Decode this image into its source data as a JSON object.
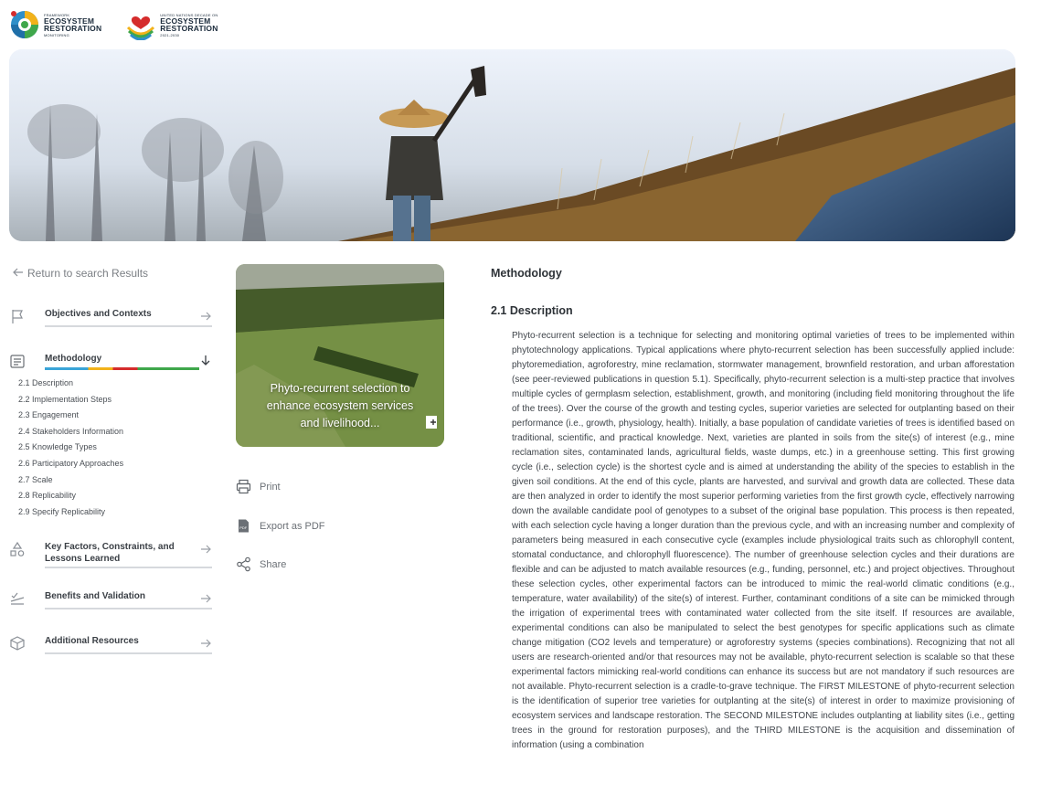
{
  "logos": {
    "framework": {
      "line1": "FRAMEWORK",
      "line2": "ECOSYSTEM",
      "line3": "RESTORATION",
      "line4": "MONITORING"
    },
    "undecade": {
      "line1": "UNITED NATIONS DECADE ON",
      "line2": "ECOSYSTEM",
      "line3": "RESTORATION",
      "line4": "2021-2030"
    }
  },
  "sidebar": {
    "back_label": "Return to search Results",
    "items": [
      {
        "label": "Objectives and Contexts",
        "icon": "flag-icon"
      },
      {
        "label": "Methodology",
        "icon": "list-icon"
      },
      {
        "label": "Key Factors, Constraints, and Lessons Learned",
        "icon": "shapes-icon"
      },
      {
        "label": "Benefits and Validation",
        "icon": "checklist-icon"
      },
      {
        "label": "Additional Resources",
        "icon": "cube-icon"
      }
    ],
    "methodology_subitems": [
      "2.1 Description",
      "2.2 Implementation Steps",
      "2.3 Engagement",
      "2.4 Stakeholders Information",
      "2.5 Knowledge Types",
      "2.6 Participatory Approaches",
      "2.7 Scale",
      "2.8 Replicability",
      "2.9 Specify Replicability"
    ]
  },
  "card": {
    "caption_line1": "Phyto-recurrent selection to",
    "caption_line2": "enhance ecosystem services",
    "caption_line3": "and livelihood..."
  },
  "actions": {
    "print": "Print",
    "export": "Export as PDF",
    "share": "Share"
  },
  "content": {
    "section_title": "Methodology",
    "subsection_title": "2.1 Description",
    "description": "Phyto-recurrent selection is a technique for selecting and monitoring optimal varieties of trees to be implemented within phytotechnology applications. Typical applications where phyto-recurrent selection has been successfully applied include: phytoremediation, agroforestry, mine reclamation, stormwater management, brownfield restoration, and urban afforestation (see peer-reviewed publications in question 5.1). Specifically, phyto-recurrent selection is a multi-step practice that involves multiple cycles of germplasm selection, establishment, growth, and monitoring (including field monitoring throughout the life of the trees). Over the course of the growth and testing cycles, superior varieties are selected for outplanting based on their performance (i.e., growth, physiology, health). Initially, a base population of candidate varieties of trees is identified based on traditional, scientific, and practical knowledge. Next, varieties are planted in soils from the site(s) of interest (e.g., mine reclamation sites, contaminated lands, agricultural fields, waste dumps, etc.) in a greenhouse setting. This first growing cycle (i.e., selection cycle) is the shortest cycle and is aimed at understanding the ability of the species to establish in the given soil conditions. At the end of this cycle, plants are harvested, and survival and growth data are collected. These data are then analyzed in order to identify the most superior performing varieties from the first growth cycle, effectively narrowing down the available candidate pool of genotypes to a subset of the original base population. This process is then repeated, with each selection cycle having a longer duration than the previous cycle, and with an increasing number and complexity of parameters being measured in each consecutive cycle (examples include physiological traits such as chlorophyll content, stomatal conductance, and chlorophyll fluorescence). The number of greenhouse selection cycles and their durations are flexible and can be adjusted to match available resources (e.g., funding, personnel, etc.) and project objectives. Throughout these selection cycles, other experimental factors can be introduced to mimic the real-world climatic conditions (e.g., temperature, water availability) of the site(s) of interest. Further, contaminant conditions of a site can be mimicked through the irrigation of experimental trees with contaminated water collected from the site itself. If resources are available, experimental conditions can also be manipulated to select the best genotypes for specific applications such as climate change mitigation (CO2 levels and temperature) or agroforestry systems (species combinations). Recognizing that not all users are research-oriented and/or that resources may not be available, phyto-recurrent selection is scalable so that these experimental factors mimicking real-world conditions can enhance its success but are not mandatory if such resources are not available. Phyto-recurrent selection is a cradle-to-grave technique. The FIRST MILESTONE of phyto-recurrent selection is the identification of superior tree varieties for outplanting at the site(s) of interest in order to maximize provisioning of ecosystem services and landscape restoration. The SECOND MILESTONE includes outplanting at liability sites (i.e., getting trees in the ground for restoration purposes), and the THIRD MILESTONE is the acquisition and dissemination of information (using a combination"
  }
}
